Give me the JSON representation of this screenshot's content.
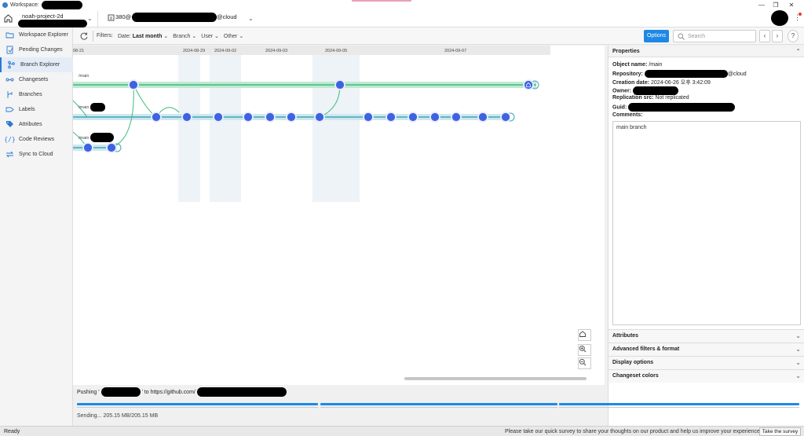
{
  "window": {
    "title": "Workspace:",
    "controls": [
      "—",
      "❐",
      "✕"
    ]
  },
  "workspace": {
    "name": "noah-project-2d",
    "repo_prefix": "380@",
    "repo_suffix": "@cloud"
  },
  "sidebar": {
    "items": [
      {
        "label": "Workspace Explorer",
        "icon": "folder-icon"
      },
      {
        "label": "Pending Changes",
        "icon": "pending-changes-icon"
      },
      {
        "label": "Branch Explorer",
        "icon": "branch-explorer-icon"
      },
      {
        "label": "Changesets",
        "icon": "changesets-icon"
      },
      {
        "label": "Branches",
        "icon": "branches-icon"
      },
      {
        "label": "Labels",
        "icon": "label-icon"
      },
      {
        "label": "Attributes",
        "icon": "attributes-icon"
      },
      {
        "label": "Code Reviews",
        "icon": "code-review-icon"
      },
      {
        "label": "Sync to Cloud",
        "icon": "sync-icon"
      }
    ]
  },
  "toolbar": {
    "filters_label": "Filters:",
    "date_label": "Date:",
    "date_value": "Last month",
    "branch_label": "Branch",
    "user_label": "User",
    "other_label": "Other",
    "options_label": "Options",
    "search_placeholder": "Search"
  },
  "graph": {
    "dates": [
      "08-21",
      "2024-08-29",
      "2024-09-02",
      "2024-09-03",
      "2024-09-05",
      "2024-09-07"
    ],
    "branch_labels": [
      "/main",
      "/main",
      "/main"
    ]
  },
  "properties": {
    "title": "Properties",
    "object_name_label": "Object name:",
    "object_name": "/main",
    "repository_label": "Repository:",
    "repository_suffix": "@cloud",
    "creation_date_label": "Creation date:",
    "creation_date": "2024-06-26 오후 3:42:09",
    "owner_label": "Owner:",
    "replication_label": "Replication src:",
    "replication_value": "Not replicated",
    "guid_label": "Guid:",
    "comments_label": "Comments:",
    "comments": "main branch",
    "sections": [
      "Attributes",
      "Advanced filters & format",
      "Display options",
      "Changeset colors"
    ]
  },
  "push": {
    "prefix": "Pushing '",
    "middle": "' to https://github.com/",
    "sending": "Sending... 205.15 MB/205.15 MB",
    "progress": 1.0
  },
  "status": {
    "left": "Ready",
    "survey_text": "Please take our quick survey to share your thoughts on our product and help us improve your experience.",
    "survey_button": "Take the survey"
  },
  "colors": {
    "accent": "#1e88e5",
    "branch_green": "#3dbb7a",
    "node_blue": "#3f63e0"
  }
}
